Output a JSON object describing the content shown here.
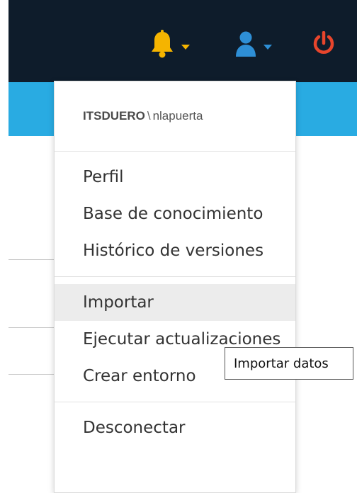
{
  "header": {
    "bg_color": "#0e1c2b",
    "accent_color": "#29abe2",
    "icons": [
      "bell-icon",
      "user-icon",
      "power-icon"
    ]
  },
  "user_menu": {
    "tenant": "ITSDUERO",
    "separator": "\\",
    "username": "nlapuerta",
    "group1": [
      "Perfil",
      "Base de conocimiento",
      "Histórico de versiones"
    ],
    "group2": [
      "Importar",
      "Ejecutar actualizaciones",
      "Crear entorno"
    ],
    "group3": [
      "Desconectar"
    ],
    "hovered_item": "Importar"
  },
  "tooltip": {
    "text": "Importar datos"
  }
}
